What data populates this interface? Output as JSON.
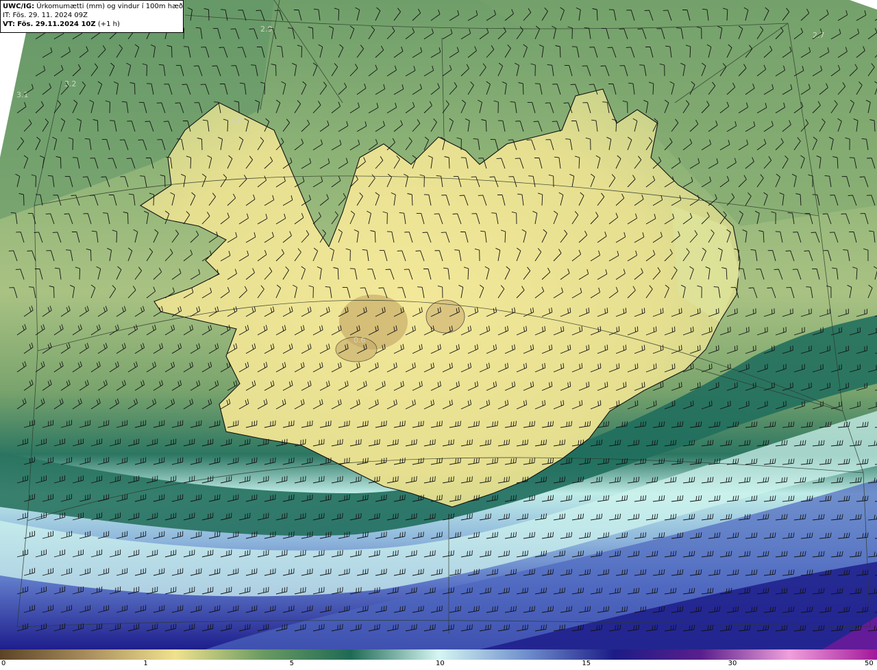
{
  "header": {
    "model_code": "UWC/IG:",
    "product_title": "Úrkomumætti (mm) og vindur í 100m hæð",
    "init_time_label": "IT:",
    "init_time": "Fös. 29. 11. 2024 09Z",
    "valid_time_label": "VT:",
    "valid_time": "Fös. 29.11.2024 10Z",
    "lead_time": "(+1 h)"
  },
  "contour_labels": [
    "2.9",
    "2.7",
    "3.2",
    "3.1",
    "3.0",
    "0.6"
  ],
  "colorbar": {
    "ticks": [
      {
        "label": "0",
        "frac": 0.0
      },
      {
        "label": "1",
        "frac": 0.1667
      },
      {
        "label": "5",
        "frac": 0.3333
      },
      {
        "label": "10",
        "frac": 0.5
      },
      {
        "label": "15",
        "frac": 0.6667
      },
      {
        "label": "30",
        "frac": 0.8333
      },
      {
        "label": "50",
        "frac": 1.0
      }
    ],
    "colors": [
      "#5b4327",
      "#a98e5e",
      "#f0e28f",
      "#6a9a62",
      "#1f6a55",
      "#d6f6f3",
      "#6f8fcd",
      "#1c1c86",
      "#5a1f8c",
      "#f0a0dc",
      "#a2169a"
    ]
  },
  "colors": {
    "land": "#f0e592",
    "sea_near": "#8fb378",
    "sea_far": "#5e9766",
    "band_dark": "#23705e",
    "band_light": "#ccf2ee",
    "south_deep": "#2a2a96",
    "coast": "#111111"
  }
}
